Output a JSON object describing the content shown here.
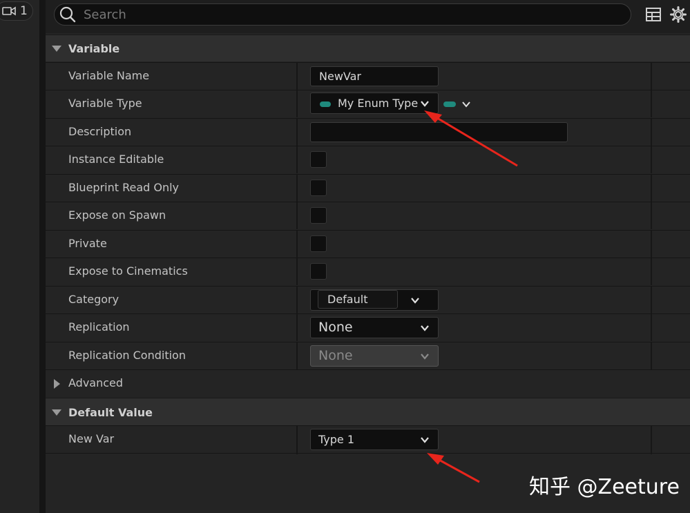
{
  "camera_chip": {
    "count": "1",
    "icon": "video-camera-icon"
  },
  "search": {
    "placeholder": "Search"
  },
  "toolbar": {
    "table_icon": "table-icon",
    "settings_icon": "gear-icon"
  },
  "sections": {
    "variable": {
      "title": "Variable"
    },
    "advanced": {
      "title": "Advanced"
    },
    "default_value": {
      "title": "Default Value"
    }
  },
  "fields": {
    "variable_name": {
      "label": "Variable Name",
      "value": "NewVar"
    },
    "variable_type": {
      "label": "Variable Type",
      "value": "My Enum Type"
    },
    "description": {
      "label": "Description",
      "value": ""
    },
    "instance_editable": {
      "label": "Instance Editable"
    },
    "blueprint_read_only": {
      "label": "Blueprint Read Only"
    },
    "expose_on_spawn": {
      "label": "Expose on Spawn"
    },
    "private": {
      "label": "Private"
    },
    "expose_to_cinematics": {
      "label": "Expose to Cinematics"
    },
    "category": {
      "label": "Category",
      "value": "Default"
    },
    "replication": {
      "label": "Replication",
      "value": "None"
    },
    "replication_condition": {
      "label": "Replication Condition",
      "value": "None"
    },
    "new_var": {
      "label": "New Var",
      "value": "Type 1"
    }
  },
  "colors": {
    "accent_pill": "#1f8a7d",
    "annotation_arrow": "#e8251c"
  },
  "watermark": {
    "text": "知乎 @Zeeture"
  }
}
